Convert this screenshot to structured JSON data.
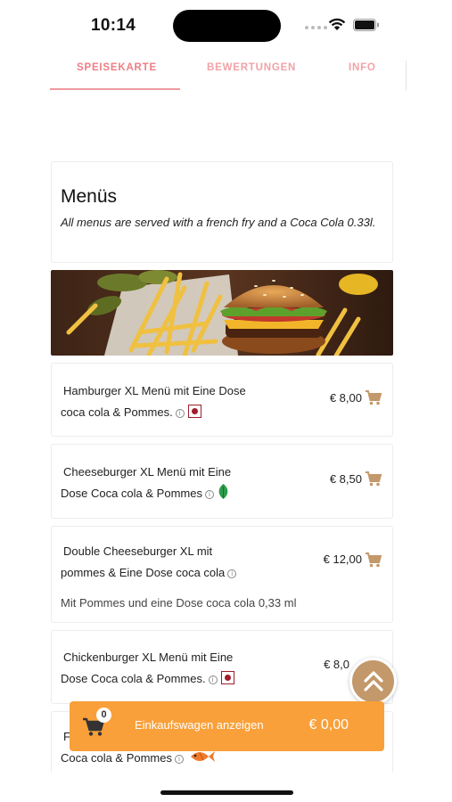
{
  "status_bar": {
    "time": "10:14"
  },
  "tabs": [
    {
      "label": "SPEISEKARTE",
      "active": true
    },
    {
      "label": "BEWERTUNGEN",
      "active": false
    },
    {
      "label": "INFO",
      "active": false
    }
  ],
  "section": {
    "title": "Menüs",
    "description": "All menus are served with a french fry and a Coca Cola 0.33l."
  },
  "items": [
    {
      "name_line1": "Hamburger XL Menü mit Eine Dose",
      "name_line2": "coca cola & Pommes.",
      "price": "€ 8,00",
      "badge": "red-square-icon"
    },
    {
      "name_line1": "Cheeseburger XL Menü mit Eine",
      "name_line2": "Dose Coca cola & Pommes",
      "price": "€ 8,50",
      "badge": "leaf-icon"
    },
    {
      "name_line1": "Double Cheeseburger XL mit",
      "name_line2": "pommes & Eine Dose coca cola",
      "price": "€ 12,00",
      "subtext": "Mit Pommes und eine Dose coca cola 0,33 ml"
    },
    {
      "name_line1": "Chickenburger XL Menü mit Eine",
      "name_line2": "Dose Coca cola & Pommes.",
      "price": "€ 8,0",
      "badge": "red-square-icon"
    },
    {
      "name_line1": "F",
      "name_line2": "Coca cola & Pommes",
      "badge": "fish-icon"
    }
  ],
  "cart": {
    "count": "0",
    "label": "Einkaufswagen anzeigen",
    "total": "€ 0,00"
  },
  "colors": {
    "accent_tab": "#ef7d85",
    "price_cart": "#c3986a",
    "cart_bar": "#f9a03a"
  }
}
